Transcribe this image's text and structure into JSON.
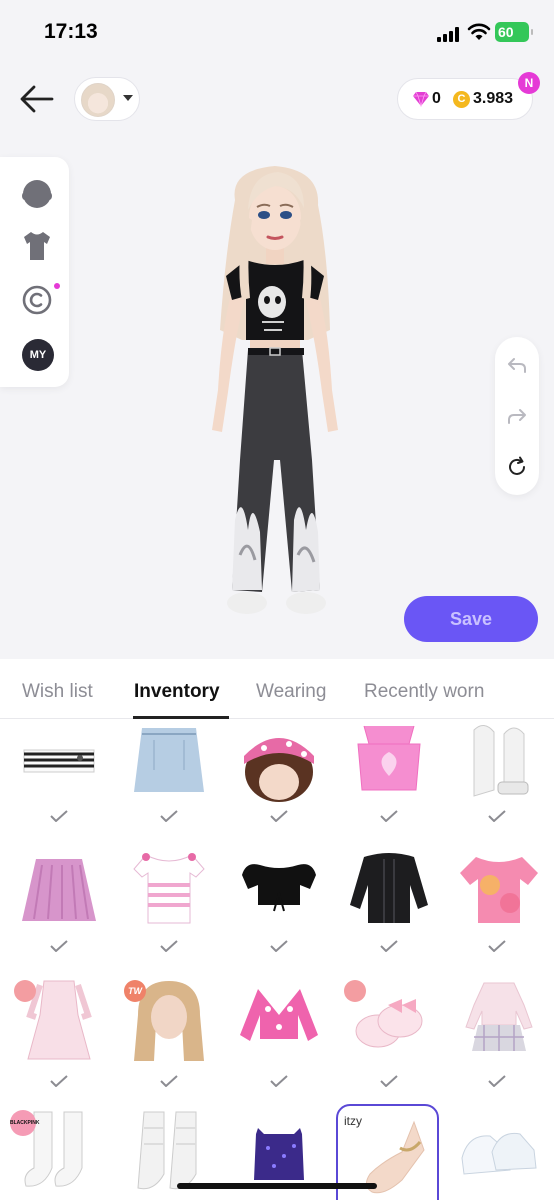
{
  "status_bar": {
    "time": "17:13",
    "battery": "60"
  },
  "header": {
    "gems": "0",
    "coins": "3.983",
    "coin_symbol": "C",
    "new_badge": "N"
  },
  "side_menu": {
    "items": [
      {
        "name": "head-icon"
      },
      {
        "name": "shirt-icon"
      },
      {
        "name": "copyright-icon"
      },
      {
        "name": "my-button",
        "label": "MY"
      }
    ]
  },
  "right_controls": [
    "undo-icon",
    "redo-icon",
    "reset-icon"
  ],
  "save_label": "Save",
  "tabs": [
    {
      "label": "Wish list",
      "active": false
    },
    {
      "label": "Inventory",
      "active": true
    },
    {
      "label": "Wearing",
      "active": false
    },
    {
      "label": "Recently worn",
      "active": false
    }
  ],
  "inventory": {
    "badges": {
      "twice": "TW",
      "blackpink": "BLACKPINK",
      "itzy": "itzy"
    },
    "rows": [
      [
        "striped-crop-top",
        "denim-skirt",
        "pink-bandana-hair",
        "pink-butterfly-top",
        "white-platform-sandals"
      ],
      [
        "pink-pleated-skirt",
        "pink-striped-tee",
        "black-puff-top",
        "black-jacket",
        "tie-dye-tee"
      ],
      [
        "pink-lace-dress",
        "blonde-long-hair",
        "pink-eye-sweater",
        "pink-bow-slippers",
        "pink-plaid-outfit"
      ],
      [
        "white-socks",
        "white-leg-warmers",
        "purple-sequin-bralette",
        "itzy-bracelet",
        "white-sneakers"
      ]
    ]
  },
  "colors": {
    "accent": "#6a56f5",
    "badge_pink": "#e53ad6",
    "battery_green": "#34c759"
  }
}
